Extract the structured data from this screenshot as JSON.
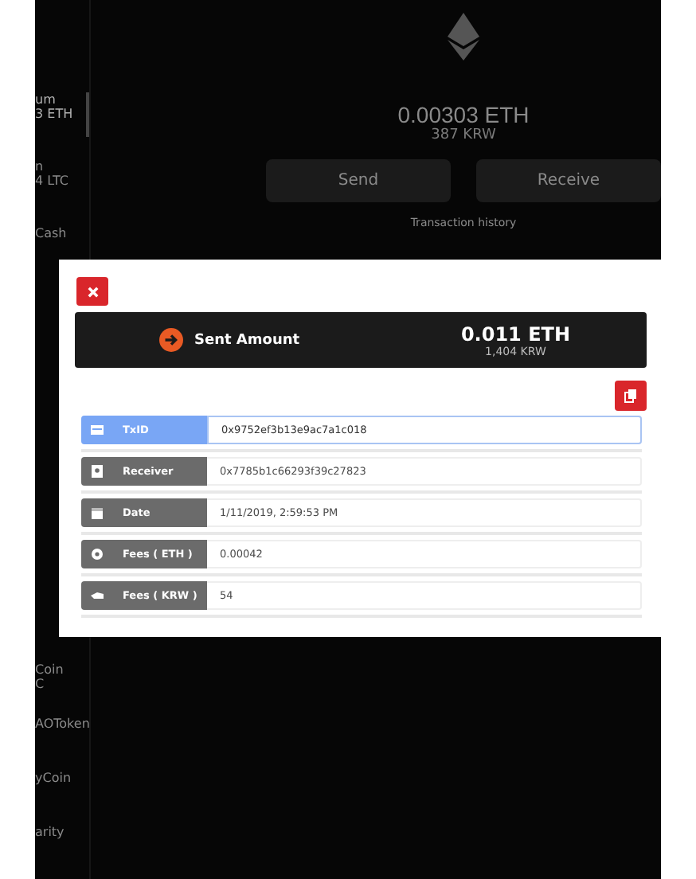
{
  "sidebar": {
    "top_items": [
      {
        "name": "um",
        "balance": "3 ETH",
        "selected": true
      },
      {
        "name": "n",
        "balance": "4 LTC",
        "selected": false
      },
      {
        "name": "Cash",
        "selected": false
      }
    ],
    "bottom_items": [
      {
        "name": "Coin",
        "balance": "C",
        "selected": false
      },
      {
        "name": "AOToken",
        "selected": false
      },
      {
        "name": "yCoin",
        "selected": false
      },
      {
        "name": "arity",
        "selected": false
      }
    ]
  },
  "wallet": {
    "amount": "0.00303 ETH",
    "fiat": "387 KRW",
    "buttons": [
      "Send",
      "Receive"
    ],
    "history_label": "Transaction history"
  },
  "modal": {
    "summary": {
      "label": "Sent Amount",
      "amount": "0.011 ETH",
      "fiat": "1,404 KRW"
    },
    "fields": [
      {
        "kind": "txid",
        "label": "TxID",
        "value": "0x9752ef3b13e9ac7a1c018",
        "selected": true
      },
      {
        "kind": "receiver",
        "label": "Receiver",
        "value": "0x7785b1c66293f39c27823",
        "selected": false
      },
      {
        "kind": "date",
        "label": "Date",
        "value": "1/11/2019, 2:59:53 PM",
        "selected": false
      },
      {
        "kind": "fee",
        "label": "Fees ( ETH )",
        "value": "0.00042",
        "selected": false
      },
      {
        "kind": "fiat",
        "label": "Fees ( KRW )",
        "value": "54",
        "selected": false
      }
    ]
  }
}
